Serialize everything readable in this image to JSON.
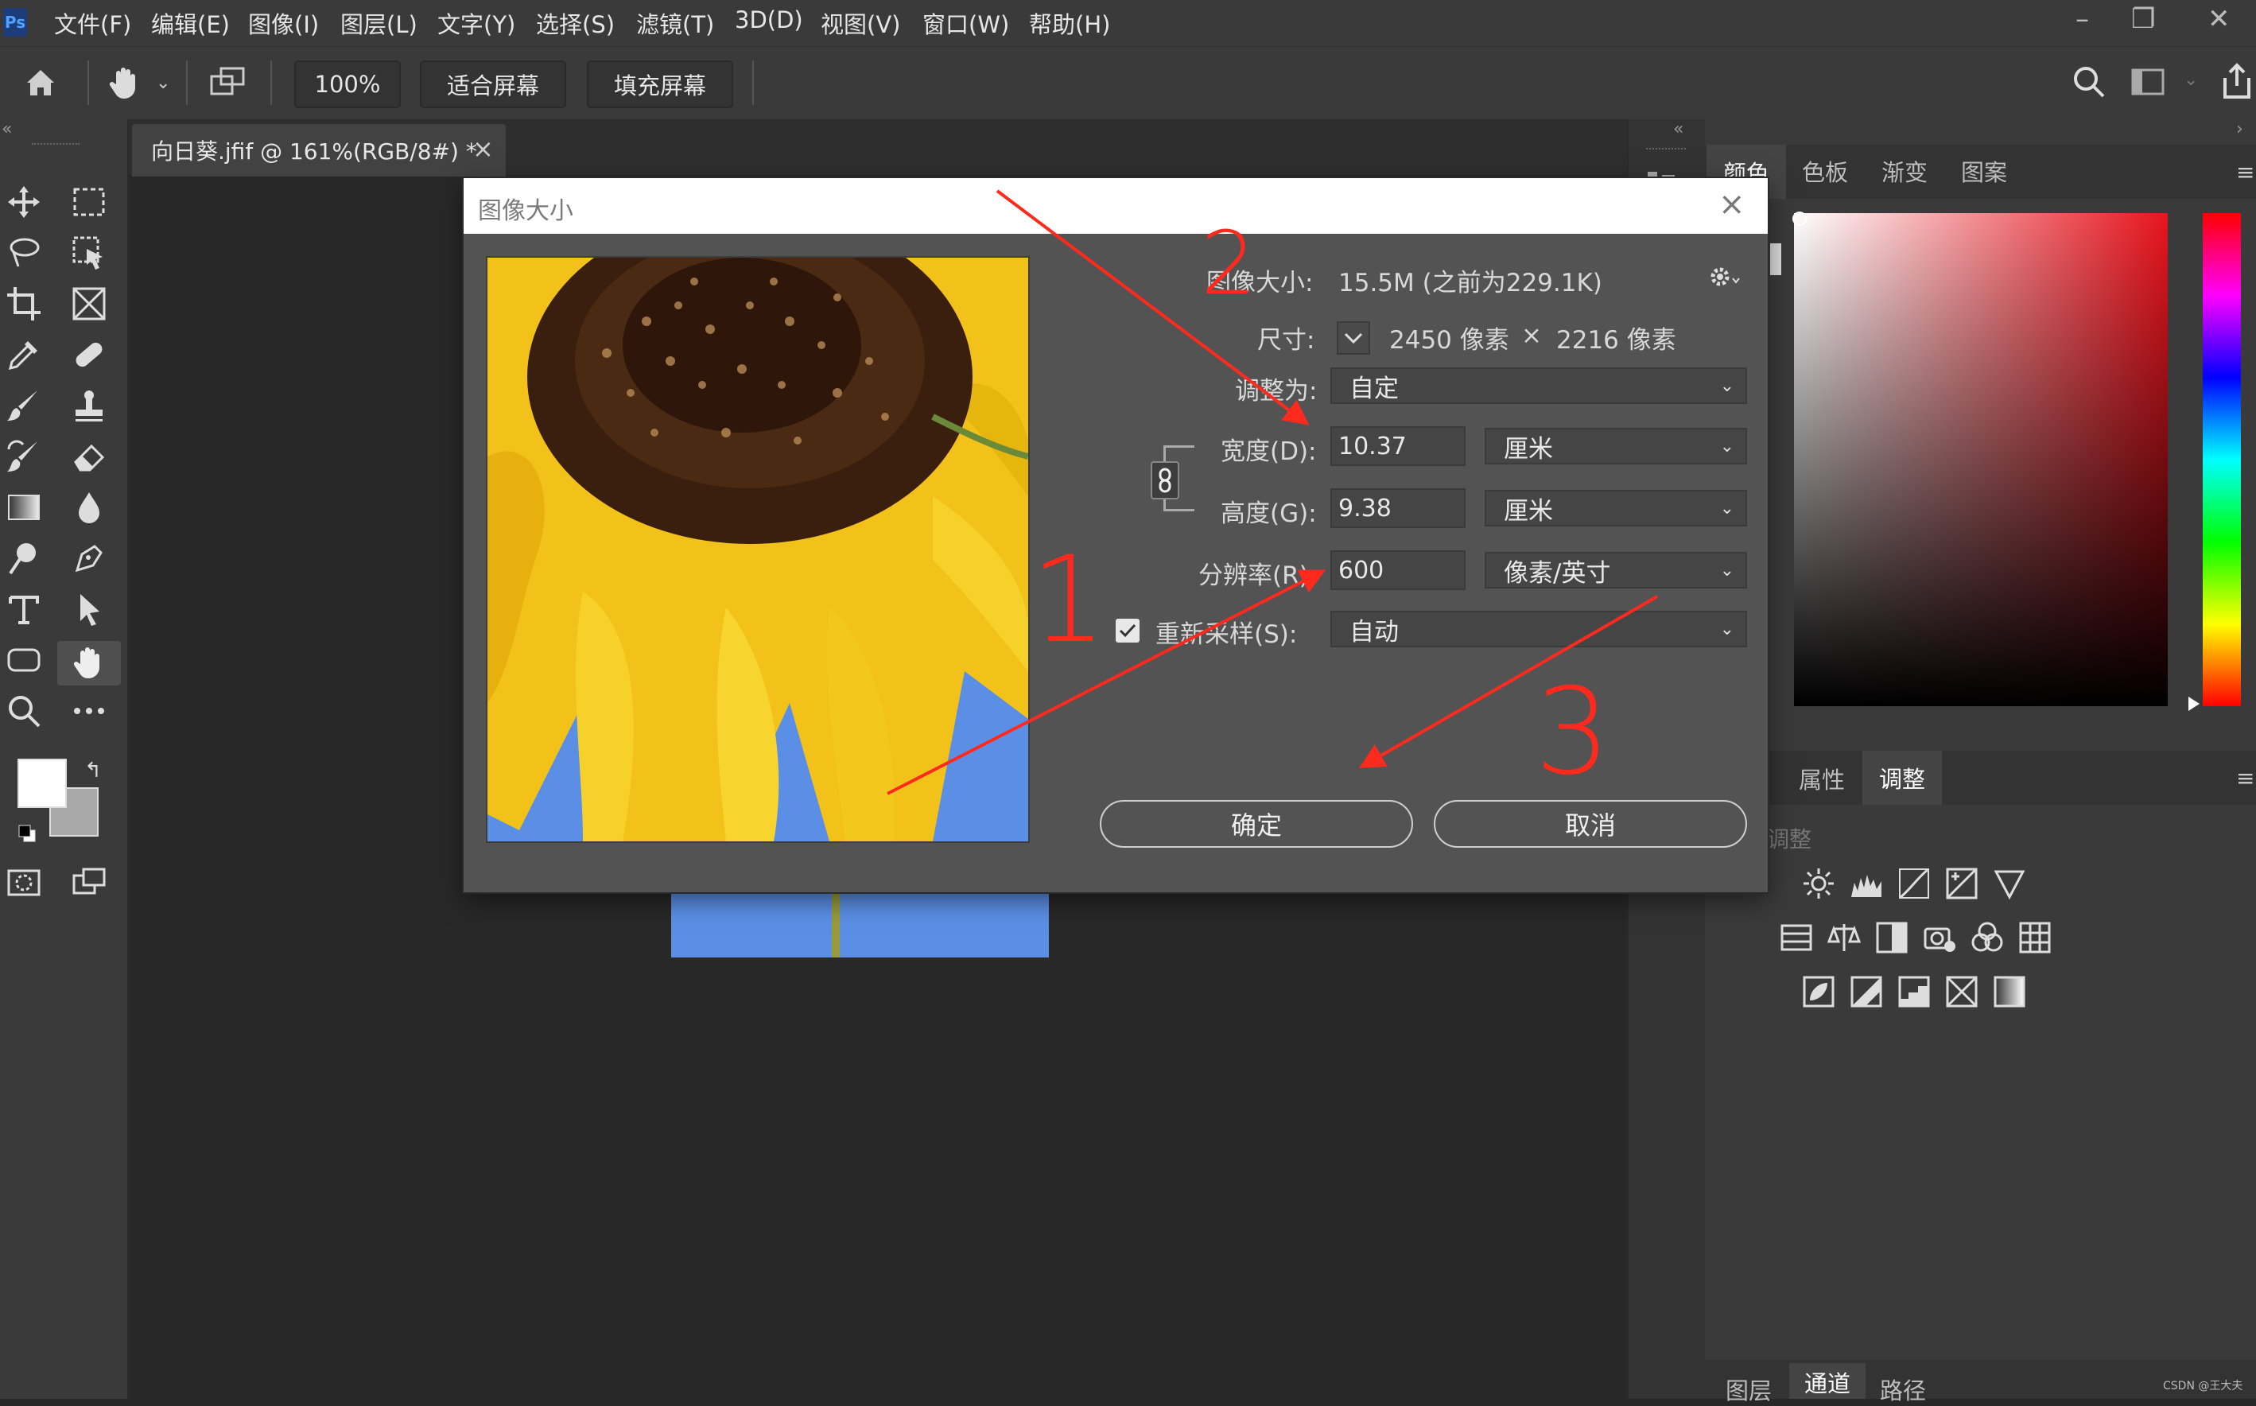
{
  "app": {
    "logo": "Ps"
  },
  "menu": [
    "文件(F)",
    "编辑(E)",
    "图像(I)",
    "图层(L)",
    "文字(Y)",
    "选择(S)",
    "滤镜(T)",
    "3D(D)",
    "视图(V)",
    "窗口(W)",
    "帮助(H)"
  ],
  "window_controls": {
    "minimize": "–",
    "restore": "❐",
    "close": "✕"
  },
  "options_bar": {
    "zoom": "100%",
    "fit_screen": "适合屏幕",
    "fill_screen": "填充屏幕"
  },
  "document_tab": {
    "title": "向日葵.jfif @ 161%(RGB/8#) *",
    "close": "×"
  },
  "right_panel": {
    "top_tabs": [
      "颜色",
      "色板",
      "渐变",
      "图案"
    ],
    "mid_tabs": [
      "属性",
      "调整"
    ],
    "adjust_hint": "调整",
    "bottom_tabs": [
      "图层",
      "通道",
      "路径"
    ]
  },
  "dialog": {
    "title": "图像大小",
    "image_size_label": "图像大小:",
    "image_size_value": "15.5M (之前为229.1K)",
    "dimensions_label": "尺寸:",
    "dim_width": "2450 像素",
    "dim_x": "×",
    "dim_height": "2216 像素",
    "fit_to_label": "调整为:",
    "fit_to_value": "自定",
    "width_label": "宽度(D):",
    "width_value": "10.37",
    "width_unit": "厘米",
    "height_label": "高度(G):",
    "height_value": "9.38",
    "height_unit": "厘米",
    "resolution_label": "分辨率(R):",
    "resolution_value": "600",
    "resolution_unit": "像素/英寸",
    "resample_label": "重新采样(S):",
    "resample_checked": true,
    "resample_value": "自动",
    "ok": "确定",
    "cancel": "取消"
  },
  "annotations": [
    "1",
    "2",
    "3"
  ],
  "watermark": "CSDN @王大夫",
  "colors": {
    "annotation_red": "#ff2a1e",
    "sky_blue": "#5b8fe6",
    "panel_bg": "#3a3a3a"
  }
}
